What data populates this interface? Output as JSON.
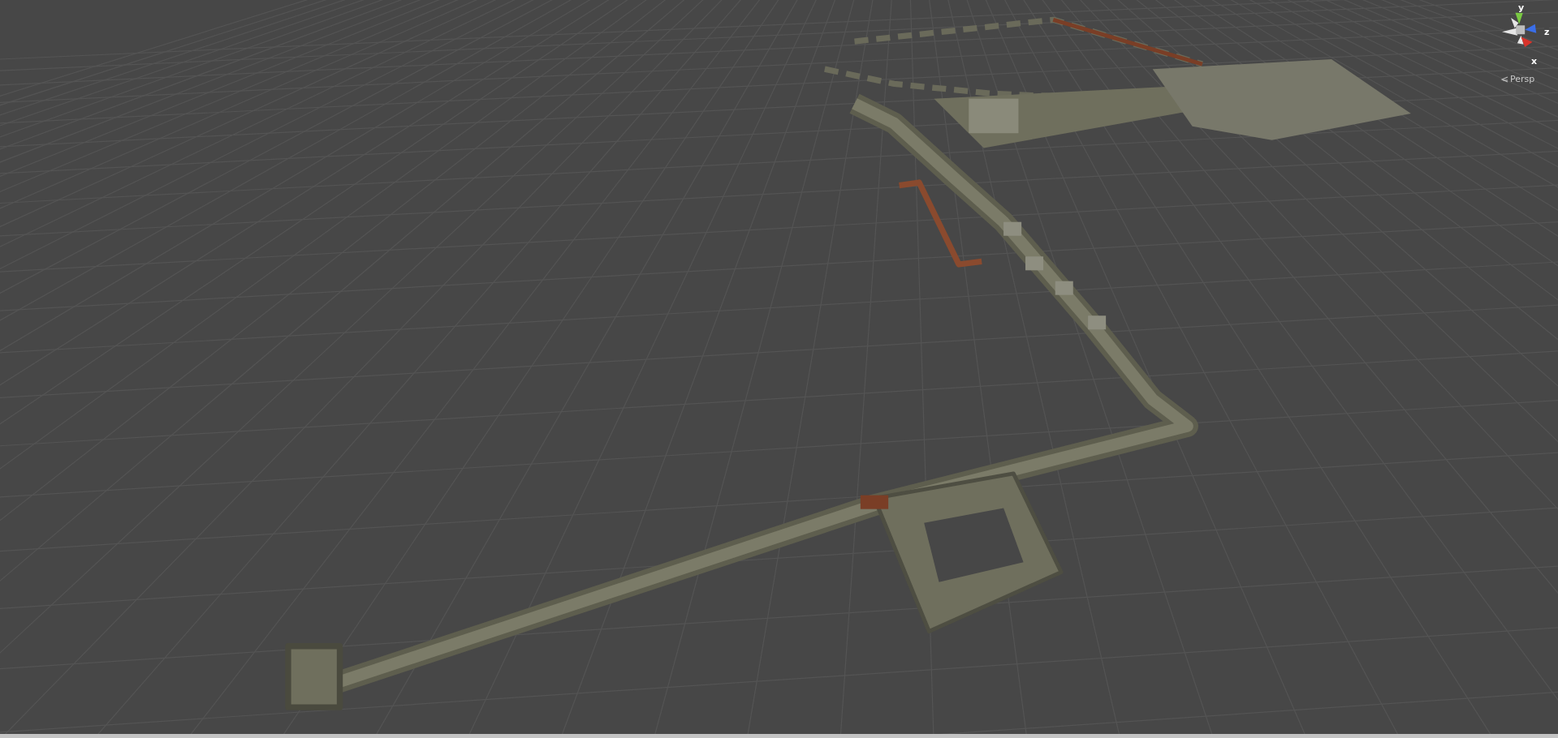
{
  "scene_view": {
    "gizmo": {
      "axes": [
        {
          "label": "y",
          "color": "#7ac943"
        },
        {
          "label": "z",
          "color": "#3a6ee8"
        },
        {
          "label": "x",
          "color": "#d9342b"
        }
      ]
    },
    "projection": "Persp"
  }
}
